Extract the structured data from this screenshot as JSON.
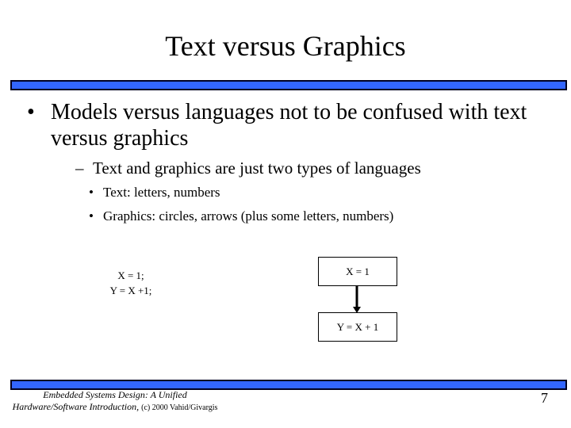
{
  "slide": {
    "title": "Text versus Graphics",
    "bullets": {
      "level1": "Models versus languages not to be confused with text versus graphics",
      "level2": "Text and graphics are just two types of languages",
      "level3": [
        "Text: letters, numbers",
        "Graphics: circles, arrows (plus some letters, numbers)"
      ],
      "markers": {
        "bullet": "•",
        "dash": "–"
      }
    },
    "example": {
      "text_program": [
        "X = 1;",
        "Y = X +1;"
      ],
      "graphic_program": {
        "box1": "X = 1",
        "box2": "Y = X + 1"
      }
    },
    "footer": {
      "line1": "Embedded Systems Design: A Unified",
      "line2_italic": "Hardware/Software Introduction,",
      "line2_plain": "(c) 2000 Vahid/Givargis",
      "page_number": "7"
    },
    "colors": {
      "bar": "#3366ff",
      "bar_border": "#000020"
    }
  }
}
